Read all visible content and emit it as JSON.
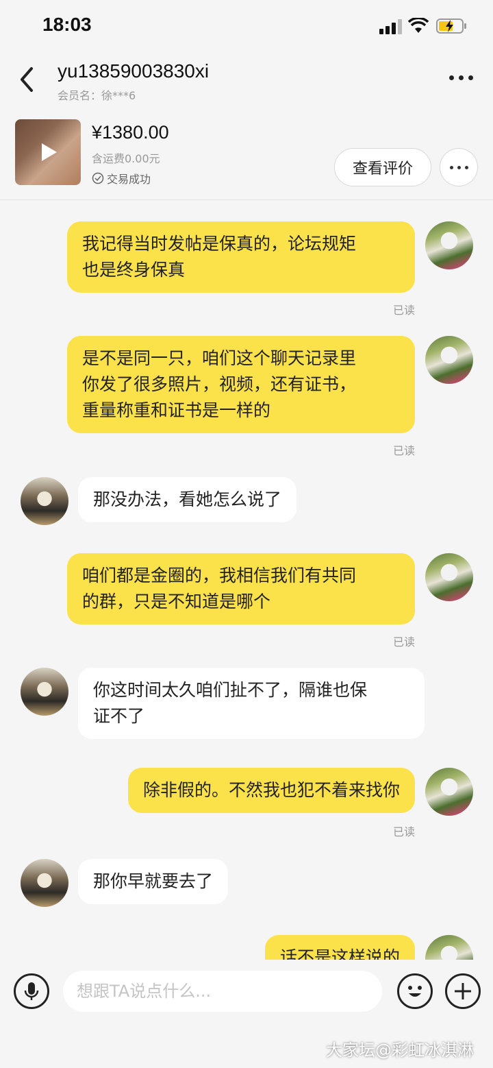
{
  "status_bar": {
    "time": "18:03"
  },
  "header": {
    "title": "yu13859003830xi",
    "member_label": "会员名：徐***6"
  },
  "product": {
    "price": "¥1380.00",
    "shipping": "含运费0.00元",
    "trade_status": "交易成功",
    "review_button": "查看评价"
  },
  "messages": [
    {
      "sender": "me",
      "lines": [
        "我记得当时发帖是保真的，论坛规矩",
        "也是终身保真"
      ],
      "read": "已读"
    },
    {
      "sender": "me",
      "lines": [
        "是不是同一只，咱们这个聊天记录里",
        "你发了很多照片，视频，还有证书，",
        "重量称重和证书是一样的"
      ],
      "read": "已读"
    },
    {
      "sender": "other",
      "lines": [
        "那没办法，看她怎么说了"
      ]
    },
    {
      "sender": "me",
      "lines": [
        "咱们都是金圈的，我相信我们有共同",
        "的群，只是不知道是哪个"
      ],
      "read": "已读"
    },
    {
      "sender": "other",
      "lines": [
        "你这时间太久咱们扯不了，隔谁也保",
        "证不了"
      ]
    },
    {
      "sender": "me",
      "lines": [
        "除非假的。不然我也犯不着来找你"
      ],
      "read": "已读"
    },
    {
      "sender": "other",
      "lines": [
        "那你早就要去了"
      ]
    },
    {
      "sender": "me",
      "lines": [
        "话不是这样说的"
      ]
    }
  ],
  "input": {
    "placeholder": "想跟TA说点什么..."
  },
  "watermark": "大家坛@彩虹冰淇淋",
  "colors": {
    "my_bubble": "#fbe14a",
    "other_bubble": "#ffffff",
    "background": "#f5f5f5"
  },
  "icons": [
    "back-arrow-icon",
    "more-dots-icon",
    "play-icon",
    "check-circle-icon",
    "microphone-icon",
    "emoji-icon",
    "plus-icon"
  ]
}
